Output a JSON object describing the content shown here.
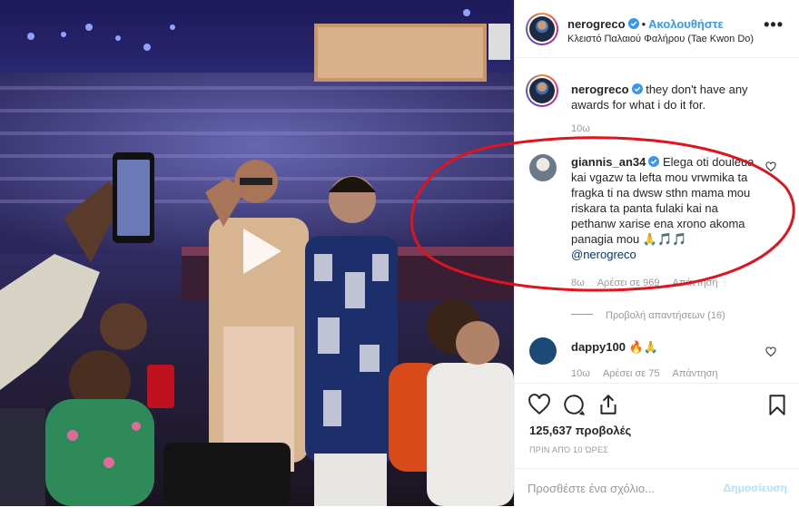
{
  "post": {
    "author": "nerogreco",
    "follow_label": "Ακολουθήστε",
    "dot": "•",
    "location": "Κλειστό Παλαιού Φαλήρου (Tae Kwon Do)",
    "more_label": "•••"
  },
  "caption": {
    "username": "nerogreco",
    "text": "they don't have any awards for what i do it for.",
    "age": "10ω"
  },
  "comment1": {
    "username": "giannis_an34",
    "text": "Elega oti douleua kai vgazw ta lefta mou vrwmika ta fragka ti na dwsw sthn mama mou riskara ta panta fulaki kai na pethanw xarise ena xrono akoma panagia mou 🙏🎵🎵",
    "mention": "@nerogreco",
    "age": "8ω",
    "likes": "Αρέσει σε 969",
    "reply": "Απάντηση",
    "view_replies": "Προβολή απαντήσεων (16)"
  },
  "comment2": {
    "username": "dappy100",
    "text": "🔥🙏",
    "age": "10ω",
    "likes": "Αρέσει σε 75",
    "reply": "Απάντηση"
  },
  "stats": {
    "views": "125,637 προβολές",
    "time": "ΠΡΙΝ ΑΠΌ 10 ΏΡΕΣ"
  },
  "compose": {
    "placeholder": "Προσθέστε ένα σχόλιο...",
    "post_label": "Δημοσίευση"
  },
  "icons": {
    "heart": "heart-icon",
    "comment": "comment-icon",
    "share": "share-icon",
    "save": "bookmark-icon",
    "play": "play-icon",
    "verified": "verified-badge-icon"
  },
  "colors": {
    "accent": "#3897f0",
    "verified": "#3897f0",
    "annotation": "#e0141e",
    "post_disabled": "#b2dffc"
  }
}
